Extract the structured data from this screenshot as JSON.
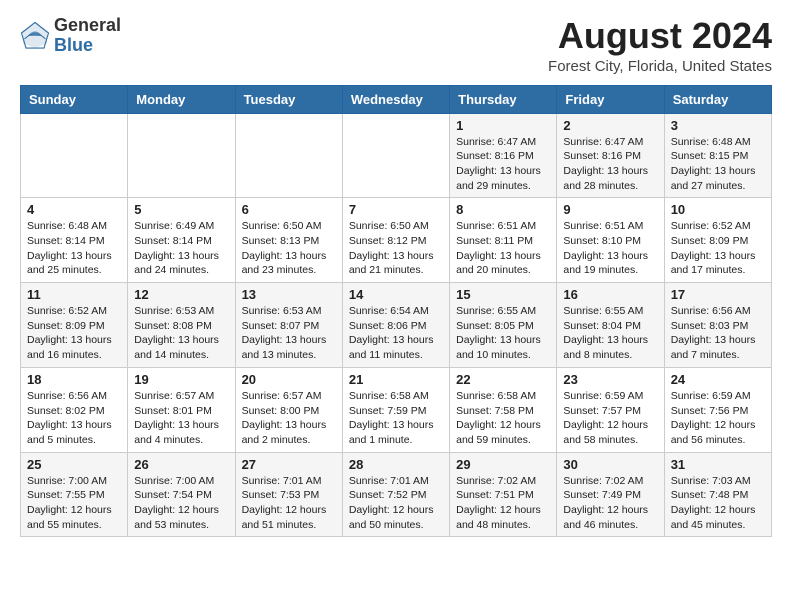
{
  "logo": {
    "general": "General",
    "blue": "Blue"
  },
  "header": {
    "title": "August 2024",
    "subtitle": "Forest City, Florida, United States"
  },
  "days_of_week": [
    "Sunday",
    "Monday",
    "Tuesday",
    "Wednesday",
    "Thursday",
    "Friday",
    "Saturday"
  ],
  "weeks": [
    [
      {
        "day": "",
        "info": ""
      },
      {
        "day": "",
        "info": ""
      },
      {
        "day": "",
        "info": ""
      },
      {
        "day": "",
        "info": ""
      },
      {
        "day": "1",
        "info": "Sunrise: 6:47 AM\nSunset: 8:16 PM\nDaylight: 13 hours\nand 29 minutes."
      },
      {
        "day": "2",
        "info": "Sunrise: 6:47 AM\nSunset: 8:16 PM\nDaylight: 13 hours\nand 28 minutes."
      },
      {
        "day": "3",
        "info": "Sunrise: 6:48 AM\nSunset: 8:15 PM\nDaylight: 13 hours\nand 27 minutes."
      }
    ],
    [
      {
        "day": "4",
        "info": "Sunrise: 6:48 AM\nSunset: 8:14 PM\nDaylight: 13 hours\nand 25 minutes."
      },
      {
        "day": "5",
        "info": "Sunrise: 6:49 AM\nSunset: 8:14 PM\nDaylight: 13 hours\nand 24 minutes."
      },
      {
        "day": "6",
        "info": "Sunrise: 6:50 AM\nSunset: 8:13 PM\nDaylight: 13 hours\nand 23 minutes."
      },
      {
        "day": "7",
        "info": "Sunrise: 6:50 AM\nSunset: 8:12 PM\nDaylight: 13 hours\nand 21 minutes."
      },
      {
        "day": "8",
        "info": "Sunrise: 6:51 AM\nSunset: 8:11 PM\nDaylight: 13 hours\nand 20 minutes."
      },
      {
        "day": "9",
        "info": "Sunrise: 6:51 AM\nSunset: 8:10 PM\nDaylight: 13 hours\nand 19 minutes."
      },
      {
        "day": "10",
        "info": "Sunrise: 6:52 AM\nSunset: 8:09 PM\nDaylight: 13 hours\nand 17 minutes."
      }
    ],
    [
      {
        "day": "11",
        "info": "Sunrise: 6:52 AM\nSunset: 8:09 PM\nDaylight: 13 hours\nand 16 minutes."
      },
      {
        "day": "12",
        "info": "Sunrise: 6:53 AM\nSunset: 8:08 PM\nDaylight: 13 hours\nand 14 minutes."
      },
      {
        "day": "13",
        "info": "Sunrise: 6:53 AM\nSunset: 8:07 PM\nDaylight: 13 hours\nand 13 minutes."
      },
      {
        "day": "14",
        "info": "Sunrise: 6:54 AM\nSunset: 8:06 PM\nDaylight: 13 hours\nand 11 minutes."
      },
      {
        "day": "15",
        "info": "Sunrise: 6:55 AM\nSunset: 8:05 PM\nDaylight: 13 hours\nand 10 minutes."
      },
      {
        "day": "16",
        "info": "Sunrise: 6:55 AM\nSunset: 8:04 PM\nDaylight: 13 hours\nand 8 minutes."
      },
      {
        "day": "17",
        "info": "Sunrise: 6:56 AM\nSunset: 8:03 PM\nDaylight: 13 hours\nand 7 minutes."
      }
    ],
    [
      {
        "day": "18",
        "info": "Sunrise: 6:56 AM\nSunset: 8:02 PM\nDaylight: 13 hours\nand 5 minutes."
      },
      {
        "day": "19",
        "info": "Sunrise: 6:57 AM\nSunset: 8:01 PM\nDaylight: 13 hours\nand 4 minutes."
      },
      {
        "day": "20",
        "info": "Sunrise: 6:57 AM\nSunset: 8:00 PM\nDaylight: 13 hours\nand 2 minutes."
      },
      {
        "day": "21",
        "info": "Sunrise: 6:58 AM\nSunset: 7:59 PM\nDaylight: 13 hours\nand 1 minute."
      },
      {
        "day": "22",
        "info": "Sunrise: 6:58 AM\nSunset: 7:58 PM\nDaylight: 12 hours\nand 59 minutes."
      },
      {
        "day": "23",
        "info": "Sunrise: 6:59 AM\nSunset: 7:57 PM\nDaylight: 12 hours\nand 58 minutes."
      },
      {
        "day": "24",
        "info": "Sunrise: 6:59 AM\nSunset: 7:56 PM\nDaylight: 12 hours\nand 56 minutes."
      }
    ],
    [
      {
        "day": "25",
        "info": "Sunrise: 7:00 AM\nSunset: 7:55 PM\nDaylight: 12 hours\nand 55 minutes."
      },
      {
        "day": "26",
        "info": "Sunrise: 7:00 AM\nSunset: 7:54 PM\nDaylight: 12 hours\nand 53 minutes."
      },
      {
        "day": "27",
        "info": "Sunrise: 7:01 AM\nSunset: 7:53 PM\nDaylight: 12 hours\nand 51 minutes."
      },
      {
        "day": "28",
        "info": "Sunrise: 7:01 AM\nSunset: 7:52 PM\nDaylight: 12 hours\nand 50 minutes."
      },
      {
        "day": "29",
        "info": "Sunrise: 7:02 AM\nSunset: 7:51 PM\nDaylight: 12 hours\nand 48 minutes."
      },
      {
        "day": "30",
        "info": "Sunrise: 7:02 AM\nSunset: 7:49 PM\nDaylight: 12 hours\nand 46 minutes."
      },
      {
        "day": "31",
        "info": "Sunrise: 7:03 AM\nSunset: 7:48 PM\nDaylight: 12 hours\nand 45 minutes."
      }
    ]
  ]
}
